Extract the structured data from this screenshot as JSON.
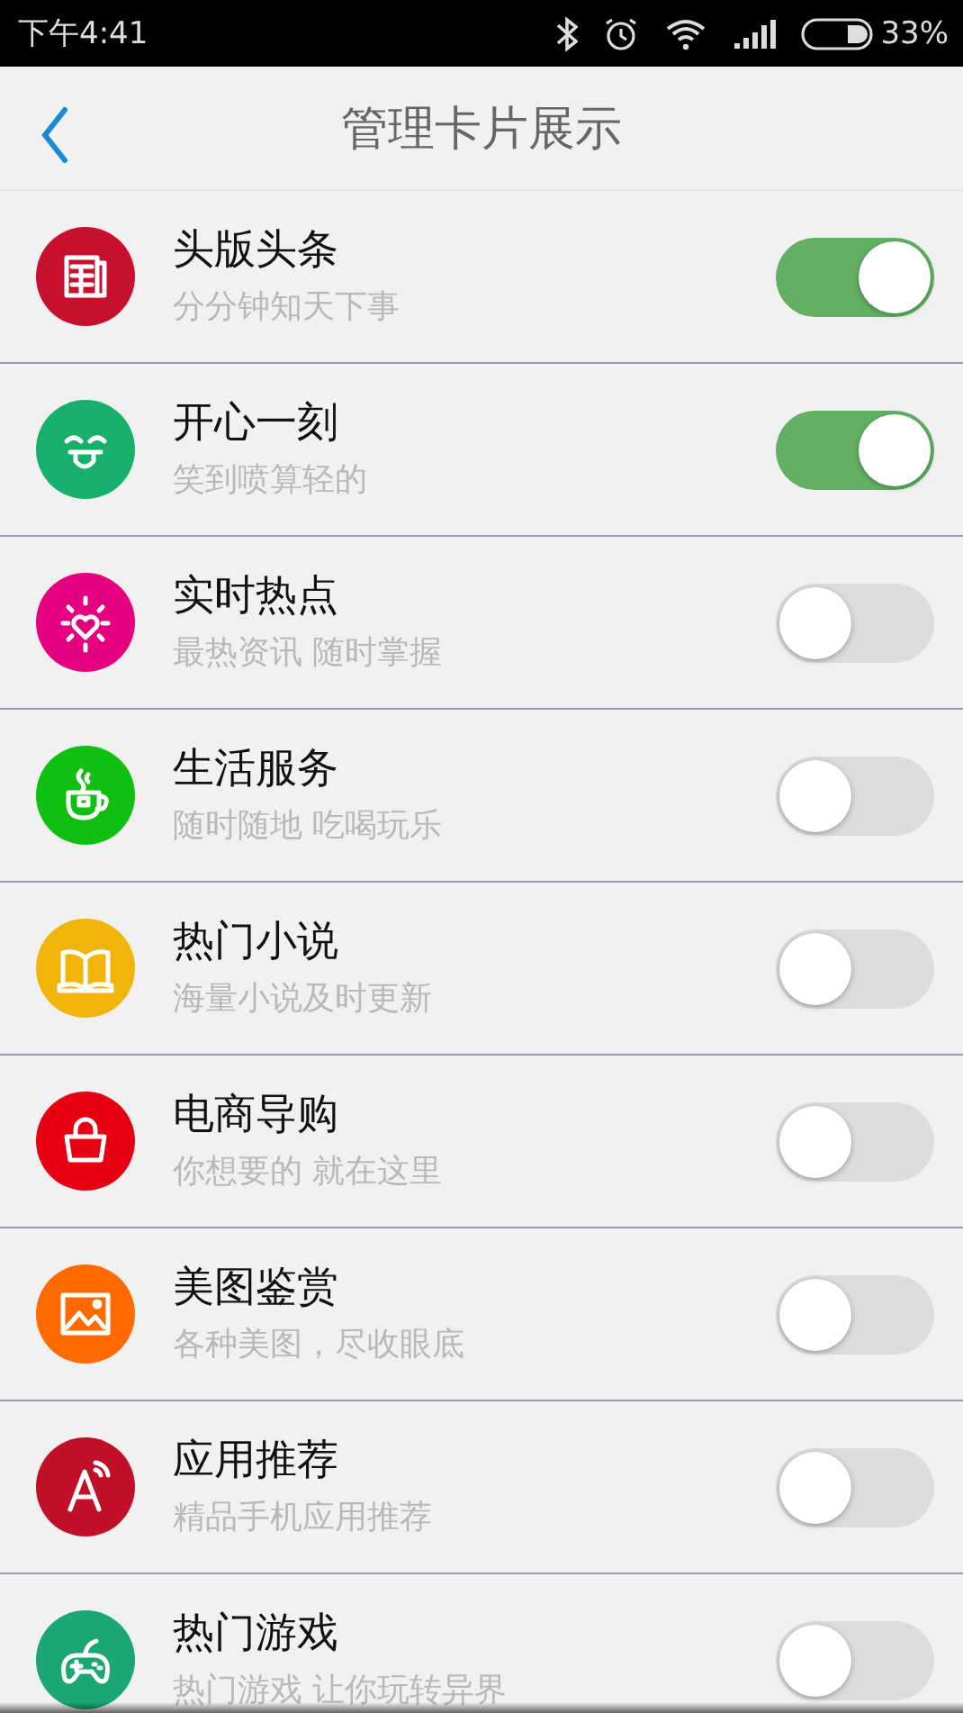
{
  "status_bar": {
    "time": "下午4:41",
    "battery": "33%"
  },
  "header": {
    "title": "管理卡片展示"
  },
  "cards": [
    {
      "kind": "news",
      "color": "#c8102e",
      "title": "头版头条",
      "subtitle": "分分钟知天下事",
      "on": true
    },
    {
      "kind": "smile",
      "color": "#17b06b",
      "title": "开心一刻",
      "subtitle": "笑到喷算轻的",
      "on": true
    },
    {
      "kind": "sun",
      "color": "#e5007f",
      "title": "实时热点",
      "subtitle": "最热资讯 随时掌握",
      "on": false
    },
    {
      "kind": "cup",
      "color": "#10c010",
      "title": "生活服务",
      "subtitle": "随时随地 吃喝玩乐",
      "on": false
    },
    {
      "kind": "book",
      "color": "#f0b40a",
      "title": "热门小说",
      "subtitle": "海量小说及时更新",
      "on": false
    },
    {
      "kind": "bag",
      "color": "#e60012",
      "title": "电商导购",
      "subtitle": "你想要的 就在这里",
      "on": false
    },
    {
      "kind": "image",
      "color": "#ff6a00",
      "title": "美图鉴赏",
      "subtitle": "各种美图，尽收眼底",
      "on": false
    },
    {
      "kind": "app",
      "color": "#c20f28",
      "title": "应用推荐",
      "subtitle": "精品手机应用推荐",
      "on": false
    },
    {
      "kind": "game",
      "color": "#1aa774",
      "title": "热门游戏",
      "subtitle": "热门游戏 让你玩转异界",
      "on": false
    }
  ]
}
